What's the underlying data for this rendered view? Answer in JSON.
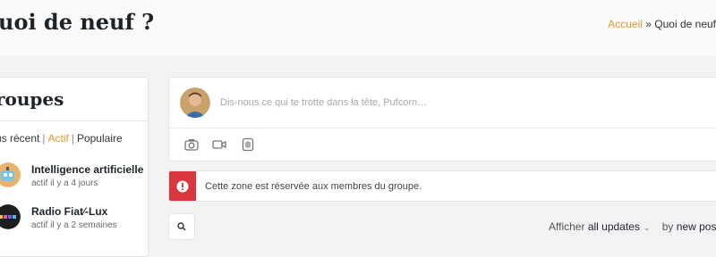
{
  "header": {
    "title": "uoi de neuf ?",
    "breadcrumb": {
      "home": "Accueil",
      "separator": " » ",
      "current": "Quoi de neuf"
    }
  },
  "sidebar": {
    "title": "roupes",
    "filters": {
      "recent": "us récent",
      "separator": "|",
      "active": "Actif",
      "popular": "Populaire"
    },
    "groups": [
      {
        "name": "Intelligence artificielle",
        "meta": "actif il y a 4 jours",
        "icon": "robot-avatar"
      },
      {
        "name": "Radio Fiat⁄-Lux",
        "meta": "actif il y a 2 semaines",
        "icon": "radio-logo"
      }
    ]
  },
  "composer": {
    "placeholder": "Dis-nous ce qui te trotte dans la tête, Pufcorn…",
    "tools": [
      "camera-icon",
      "video-icon",
      "attachment-icon"
    ]
  },
  "notice": {
    "text": "Cette zone est réservée aux membres du groupe.",
    "accent": "#d9363e",
    "icon": "alert-icon"
  },
  "feed_controls": {
    "show_prefix": "Afficher",
    "show_value": "all updates",
    "sort_prefix": "by",
    "sort_value": "new posts"
  },
  "colors": {
    "accent": "#e59a2e",
    "danger": "#d9363e"
  }
}
